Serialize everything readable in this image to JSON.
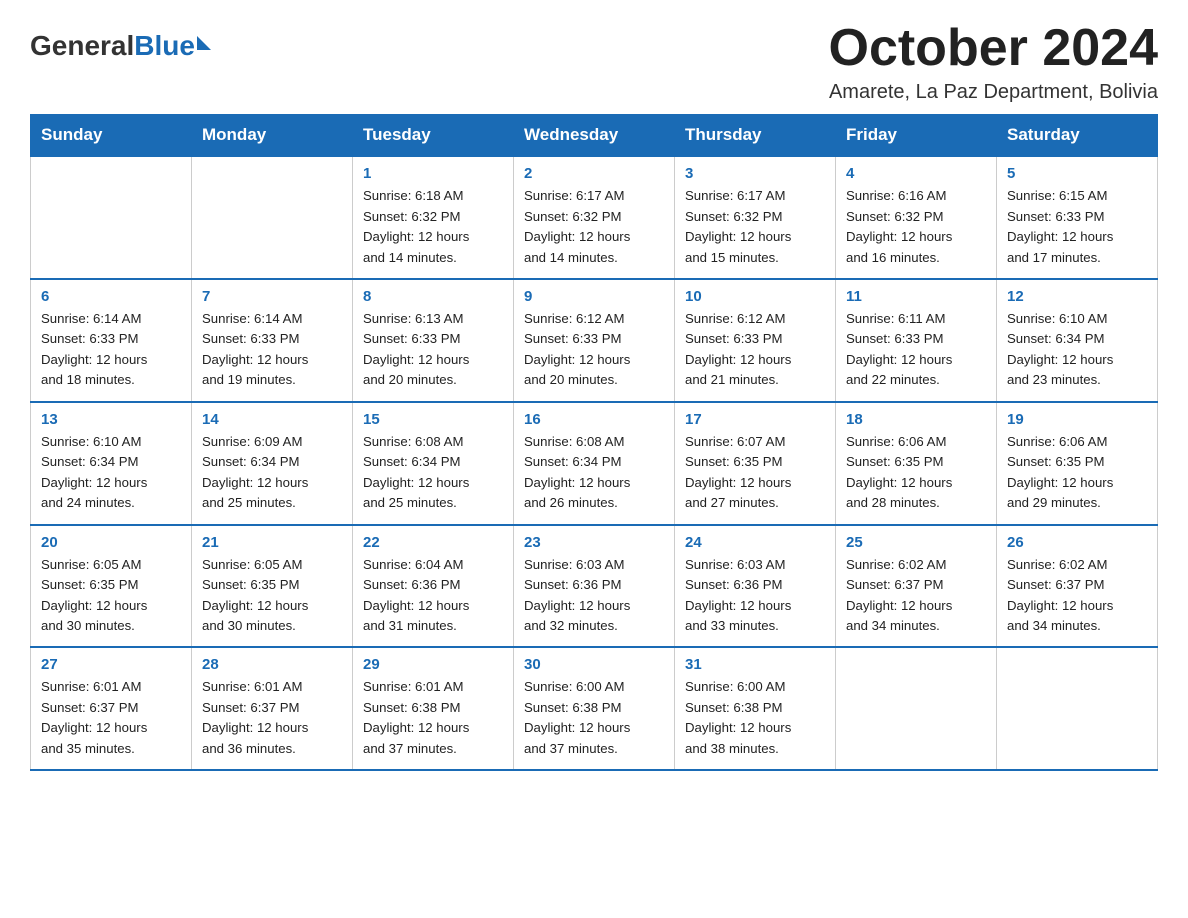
{
  "header": {
    "logo": {
      "general": "General",
      "blue": "Blue"
    },
    "title": "October 2024",
    "location": "Amarete, La Paz Department, Bolivia"
  },
  "weekdays": [
    "Sunday",
    "Monday",
    "Tuesday",
    "Wednesday",
    "Thursday",
    "Friday",
    "Saturday"
  ],
  "weeks": [
    [
      {
        "day": "",
        "info": ""
      },
      {
        "day": "",
        "info": ""
      },
      {
        "day": "1",
        "info": "Sunrise: 6:18 AM\nSunset: 6:32 PM\nDaylight: 12 hours\nand 14 minutes."
      },
      {
        "day": "2",
        "info": "Sunrise: 6:17 AM\nSunset: 6:32 PM\nDaylight: 12 hours\nand 14 minutes."
      },
      {
        "day": "3",
        "info": "Sunrise: 6:17 AM\nSunset: 6:32 PM\nDaylight: 12 hours\nand 15 minutes."
      },
      {
        "day": "4",
        "info": "Sunrise: 6:16 AM\nSunset: 6:32 PM\nDaylight: 12 hours\nand 16 minutes."
      },
      {
        "day": "5",
        "info": "Sunrise: 6:15 AM\nSunset: 6:33 PM\nDaylight: 12 hours\nand 17 minutes."
      }
    ],
    [
      {
        "day": "6",
        "info": "Sunrise: 6:14 AM\nSunset: 6:33 PM\nDaylight: 12 hours\nand 18 minutes."
      },
      {
        "day": "7",
        "info": "Sunrise: 6:14 AM\nSunset: 6:33 PM\nDaylight: 12 hours\nand 19 minutes."
      },
      {
        "day": "8",
        "info": "Sunrise: 6:13 AM\nSunset: 6:33 PM\nDaylight: 12 hours\nand 20 minutes."
      },
      {
        "day": "9",
        "info": "Sunrise: 6:12 AM\nSunset: 6:33 PM\nDaylight: 12 hours\nand 20 minutes."
      },
      {
        "day": "10",
        "info": "Sunrise: 6:12 AM\nSunset: 6:33 PM\nDaylight: 12 hours\nand 21 minutes."
      },
      {
        "day": "11",
        "info": "Sunrise: 6:11 AM\nSunset: 6:33 PM\nDaylight: 12 hours\nand 22 minutes."
      },
      {
        "day": "12",
        "info": "Sunrise: 6:10 AM\nSunset: 6:34 PM\nDaylight: 12 hours\nand 23 minutes."
      }
    ],
    [
      {
        "day": "13",
        "info": "Sunrise: 6:10 AM\nSunset: 6:34 PM\nDaylight: 12 hours\nand 24 minutes."
      },
      {
        "day": "14",
        "info": "Sunrise: 6:09 AM\nSunset: 6:34 PM\nDaylight: 12 hours\nand 25 minutes."
      },
      {
        "day": "15",
        "info": "Sunrise: 6:08 AM\nSunset: 6:34 PM\nDaylight: 12 hours\nand 25 minutes."
      },
      {
        "day": "16",
        "info": "Sunrise: 6:08 AM\nSunset: 6:34 PM\nDaylight: 12 hours\nand 26 minutes."
      },
      {
        "day": "17",
        "info": "Sunrise: 6:07 AM\nSunset: 6:35 PM\nDaylight: 12 hours\nand 27 minutes."
      },
      {
        "day": "18",
        "info": "Sunrise: 6:06 AM\nSunset: 6:35 PM\nDaylight: 12 hours\nand 28 minutes."
      },
      {
        "day": "19",
        "info": "Sunrise: 6:06 AM\nSunset: 6:35 PM\nDaylight: 12 hours\nand 29 minutes."
      }
    ],
    [
      {
        "day": "20",
        "info": "Sunrise: 6:05 AM\nSunset: 6:35 PM\nDaylight: 12 hours\nand 30 minutes."
      },
      {
        "day": "21",
        "info": "Sunrise: 6:05 AM\nSunset: 6:35 PM\nDaylight: 12 hours\nand 30 minutes."
      },
      {
        "day": "22",
        "info": "Sunrise: 6:04 AM\nSunset: 6:36 PM\nDaylight: 12 hours\nand 31 minutes."
      },
      {
        "day": "23",
        "info": "Sunrise: 6:03 AM\nSunset: 6:36 PM\nDaylight: 12 hours\nand 32 minutes."
      },
      {
        "day": "24",
        "info": "Sunrise: 6:03 AM\nSunset: 6:36 PM\nDaylight: 12 hours\nand 33 minutes."
      },
      {
        "day": "25",
        "info": "Sunrise: 6:02 AM\nSunset: 6:37 PM\nDaylight: 12 hours\nand 34 minutes."
      },
      {
        "day": "26",
        "info": "Sunrise: 6:02 AM\nSunset: 6:37 PM\nDaylight: 12 hours\nand 34 minutes."
      }
    ],
    [
      {
        "day": "27",
        "info": "Sunrise: 6:01 AM\nSunset: 6:37 PM\nDaylight: 12 hours\nand 35 minutes."
      },
      {
        "day": "28",
        "info": "Sunrise: 6:01 AM\nSunset: 6:37 PM\nDaylight: 12 hours\nand 36 minutes."
      },
      {
        "day": "29",
        "info": "Sunrise: 6:01 AM\nSunset: 6:38 PM\nDaylight: 12 hours\nand 37 minutes."
      },
      {
        "day": "30",
        "info": "Sunrise: 6:00 AM\nSunset: 6:38 PM\nDaylight: 12 hours\nand 37 minutes."
      },
      {
        "day": "31",
        "info": "Sunrise: 6:00 AM\nSunset: 6:38 PM\nDaylight: 12 hours\nand 38 minutes."
      },
      {
        "day": "",
        "info": ""
      },
      {
        "day": "",
        "info": ""
      }
    ]
  ]
}
